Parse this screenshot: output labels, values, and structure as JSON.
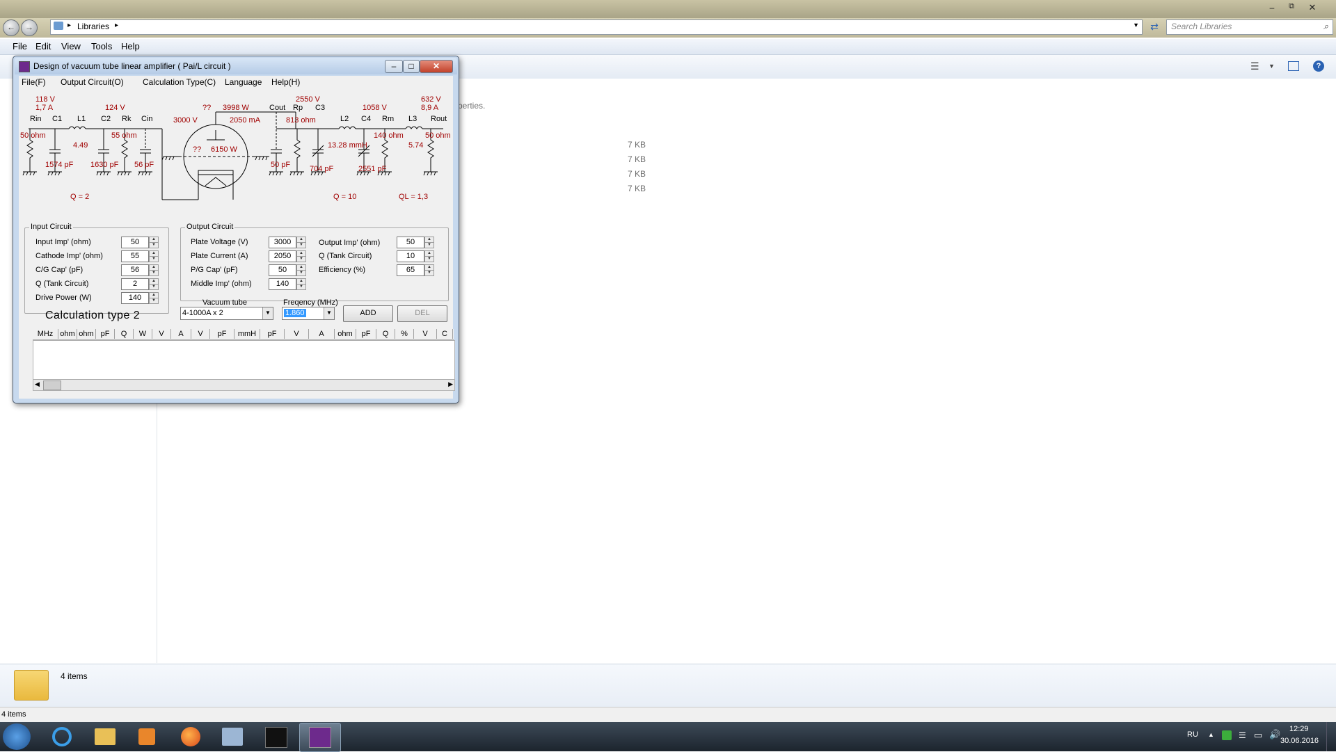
{
  "explorer": {
    "address_label": "Libraries",
    "search_placeholder": "Search Libraries",
    "menu": [
      "File",
      "Edit",
      "View",
      "Tools",
      "Help"
    ],
    "partial_text": "perties.",
    "file_sizes": [
      "7 KB",
      "7 KB",
      "7 KB",
      "7 KB"
    ],
    "details_count": "4 items",
    "status_count": "4 items"
  },
  "app": {
    "title": "Design of vacuum tube linear amplifier ( Pai/L circuit )",
    "menu": [
      "File(F)",
      "Output Circuit(O)",
      "Calculation Type(C)",
      "Language",
      "Help(H)"
    ],
    "schematic": {
      "v118": "118 V",
      "a17": "1,7 A",
      "v124": "124 V",
      "v2550": "2550 V",
      "v632": "632 V",
      "a89": "8,9 A",
      "rin": "Rin",
      "c1": "C1",
      "l1": "L1",
      "c2": "C2",
      "rk": "Rk",
      "cin": "Cin",
      "qq1": "??",
      "w3998": "3998 W",
      "cout": "Cout",
      "rp": "Rp",
      "c3": "C3",
      "v1058": "1058 V",
      "l2": "L2",
      "c4": "C4",
      "rm": "Rm",
      "l3": "L3",
      "rout": "Rout",
      "v3000": "3000 V",
      "ma2050": "2050 mA",
      "ohm813": "813 ohm",
      "ohm50a": "50 ohm",
      "ohm55": "55 ohm",
      "ohm140": "140 ohm",
      "ohm50b": "50 ohm",
      "n449": "4.49",
      "qq2": "??",
      "w6150": "6150 W",
      "mmh": "13.28 mmH",
      "n574": "5.74",
      "pf1574": "1574 pF",
      "pf1630": "1630 pF",
      "pf56": "56 pF",
      "pf50": "50 pF",
      "pf704": "704 pF",
      "pf2551": "2551 pF",
      "q2": "Q = 2",
      "q10": "Q = 10",
      "ql": "QL = 1,3"
    },
    "input_circuit": {
      "title": "Input Circuit",
      "fields": [
        {
          "label": "Input Imp' (ohm)",
          "value": "50"
        },
        {
          "label": "Cathode Imp' (ohm)",
          "value": "55"
        },
        {
          "label": "C/G Cap' (pF)",
          "value": "56"
        },
        {
          "label": "Q (Tank Circuit)",
          "value": "2"
        },
        {
          "label": "Drive Power (W)",
          "value": "140"
        }
      ]
    },
    "output_circuit": {
      "title": "Output Circuit",
      "left_fields": [
        {
          "label": "Plate Voltage (V)",
          "value": "3000"
        },
        {
          "label": "Plate Current (A)",
          "value": "2050"
        },
        {
          "label": "P/G Cap' (pF)",
          "value": "50"
        },
        {
          "label": "Middle Imp' (ohm)",
          "value": "140"
        }
      ],
      "right_fields": [
        {
          "label": "Output Imp' (ohm)",
          "value": "50"
        },
        {
          "label": "Q (Tank Circuit)",
          "value": "10"
        },
        {
          "label": "Efficiency (%)",
          "value": "65"
        }
      ]
    },
    "calc_type": "Calculation type 2",
    "vacuum_tube_label": "Vacuum tube",
    "vacuum_tube_value": "4-1000A x 2",
    "frequency_label": "Freqency (MHz)",
    "frequency_value": "1.860",
    "add_label": "ADD",
    "del_label": "DEL",
    "grid_headers": [
      "MHz",
      "ohm",
      "ohm",
      "pF",
      "Q",
      "W",
      "V",
      "A",
      "V",
      "pF",
      "mmH",
      "pF",
      "V",
      "A",
      "ohm",
      "pF",
      "Q",
      "%",
      "V",
      "C"
    ]
  },
  "taskbar": {
    "lang": "RU",
    "time": "12:29",
    "date": "30.06.2016"
  },
  "colors": {
    "schematic_red": "#a00000",
    "taskbar_bg": "#1c242d",
    "window_frame": "#c7d9ee"
  }
}
